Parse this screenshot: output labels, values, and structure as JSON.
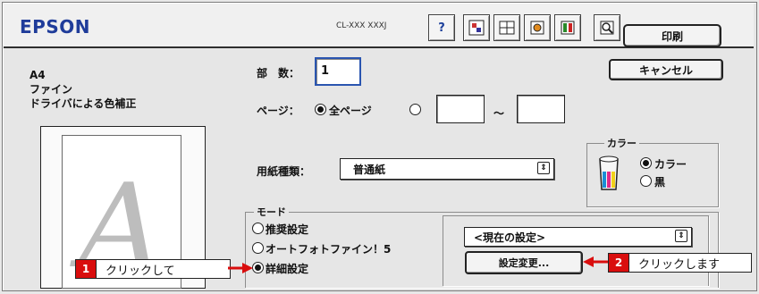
{
  "header": {
    "brand": "EPSON",
    "model": "CL-XXX XXXJ",
    "print_label": "印刷",
    "cancel_label": "キャンセル"
  },
  "info": {
    "lines": [
      "A4",
      "ファイン",
      "ドライバによる色補正"
    ],
    "preview_letter": "A"
  },
  "copies": {
    "label": "部　数：",
    "value": "1"
  },
  "pages": {
    "label": "ページ：",
    "all_label": "全ページ",
    "range_sep": "～"
  },
  "paper": {
    "label": "用紙種類：",
    "value": "普通紙"
  },
  "color": {
    "title": "カラー",
    "options": [
      "カラー",
      "黒"
    ],
    "selected": "カラー"
  },
  "mode": {
    "title": "モード",
    "options": [
      "推奨設定",
      "オートフォトファイン！5",
      "詳細設定"
    ],
    "selected": "詳細設定",
    "current_setting": "<現在の設定>",
    "change_button": "設定変更..."
  },
  "callouts": [
    {
      "number": "1",
      "text": "クリックして"
    },
    {
      "number": "2",
      "text": "クリックします"
    }
  ],
  "colors": {
    "brand": "#1f3c9a",
    "callout_badge": "#d90d0d"
  }
}
